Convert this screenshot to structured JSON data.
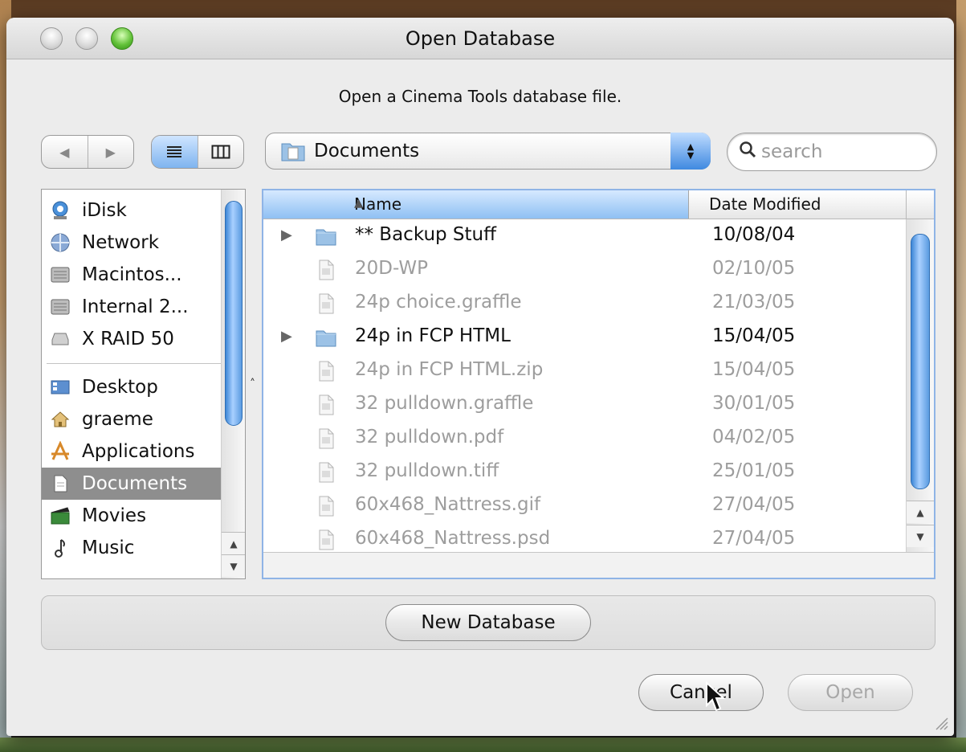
{
  "window": {
    "title": "Open Database"
  },
  "prompt": "Open a Cinema Tools database file.",
  "toolbar": {
    "back_glyph": "◀",
    "forward_glyph": "▶",
    "location": "Documents",
    "search_placeholder": "search"
  },
  "sidebar": {
    "devices": [
      {
        "label": "iDisk",
        "icon": "idisk-icon"
      },
      {
        "label": "Network",
        "icon": "network-icon"
      },
      {
        "label": "Macintos...",
        "icon": "hard-disk-icon"
      },
      {
        "label": "Internal 2...",
        "icon": "hard-disk-icon"
      },
      {
        "label": "X RAID 50",
        "icon": "drive-icon"
      }
    ],
    "places": [
      {
        "label": "Desktop",
        "icon": "desktop-icon"
      },
      {
        "label": "graeme",
        "icon": "home-icon"
      },
      {
        "label": "Applications",
        "icon": "applications-icon"
      },
      {
        "label": "Documents",
        "icon": "document-icon",
        "selected": true
      },
      {
        "label": "Movies",
        "icon": "movies-icon"
      },
      {
        "label": "Music",
        "icon": "music-icon"
      }
    ]
  },
  "columns": {
    "name": "Name",
    "date": "Date Modified"
  },
  "files": [
    {
      "name": "** Backup Stuff",
      "date": "10/08/04",
      "kind": "folder"
    },
    {
      "name": "20D-WP",
      "date": "02/10/05",
      "kind": "file"
    },
    {
      "name": "24p choice.graffle",
      "date": "21/03/05",
      "kind": "file"
    },
    {
      "name": "24p in FCP HTML",
      "date": "15/04/05",
      "kind": "folder"
    },
    {
      "name": "24p in FCP HTML.zip",
      "date": "15/04/05",
      "kind": "file"
    },
    {
      "name": "32 pulldown.graffle",
      "date": "30/01/05",
      "kind": "file"
    },
    {
      "name": "32 pulldown.pdf",
      "date": "04/02/05",
      "kind": "file"
    },
    {
      "name": "32 pulldown.tiff",
      "date": "25/01/05",
      "kind": "file"
    },
    {
      "name": "60x468_Nattress.gif",
      "date": "27/04/05",
      "kind": "file"
    },
    {
      "name": "60x468_Nattress.psd",
      "date": "27/04/05",
      "kind": "file"
    }
  ],
  "buttons": {
    "new_database": "New Database",
    "cancel": "Cancel",
    "open": "Open"
  },
  "colors": {
    "accent": "#3f89e0",
    "selection": "#8e8e8e",
    "zoom_button": "#64c23a"
  }
}
